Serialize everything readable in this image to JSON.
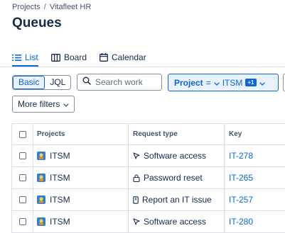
{
  "breadcrumb": {
    "root": "Projects",
    "separator": "/",
    "current": "Vitafleet HR"
  },
  "page_title": "Queues",
  "tabs": [
    {
      "label": "List",
      "icon": "list-icon",
      "active": true
    },
    {
      "label": "Board",
      "icon": "board-icon",
      "active": false
    },
    {
      "label": "Calendar",
      "icon": "calendar-icon",
      "active": false
    }
  ],
  "query_toggle": {
    "basic": "Basic",
    "jql": "JQL",
    "selected": "Basic"
  },
  "search": {
    "placeholder": "Search work",
    "value": ""
  },
  "project_filter": {
    "label": "Project",
    "operator": "=",
    "value": "ITSM",
    "extra_count": "+1"
  },
  "more_filters": "More filters",
  "table": {
    "columns": [
      "Projects",
      "Request type",
      "Key"
    ],
    "rows": [
      {
        "project": "ITSM",
        "request_type": "Software access",
        "request_icon": "cursor-icon",
        "key": "IT-278"
      },
      {
        "project": "ITSM",
        "request_type": "Password reset",
        "request_icon": "lock-icon",
        "key": "IT-265"
      },
      {
        "project": "ITSM",
        "request_type": "Report an IT issue",
        "request_icon": "device-icon",
        "key": "IT-257"
      },
      {
        "project": "ITSM",
        "request_type": "Software access",
        "request_icon": "cursor-icon",
        "key": "IT-280"
      }
    ]
  },
  "colors": {
    "accent": "#0c66e4",
    "accent_bg": "#e9f2ff",
    "text": "#172b4d",
    "border": "#dcdfe4",
    "project_icon": "#2d7fd8"
  }
}
